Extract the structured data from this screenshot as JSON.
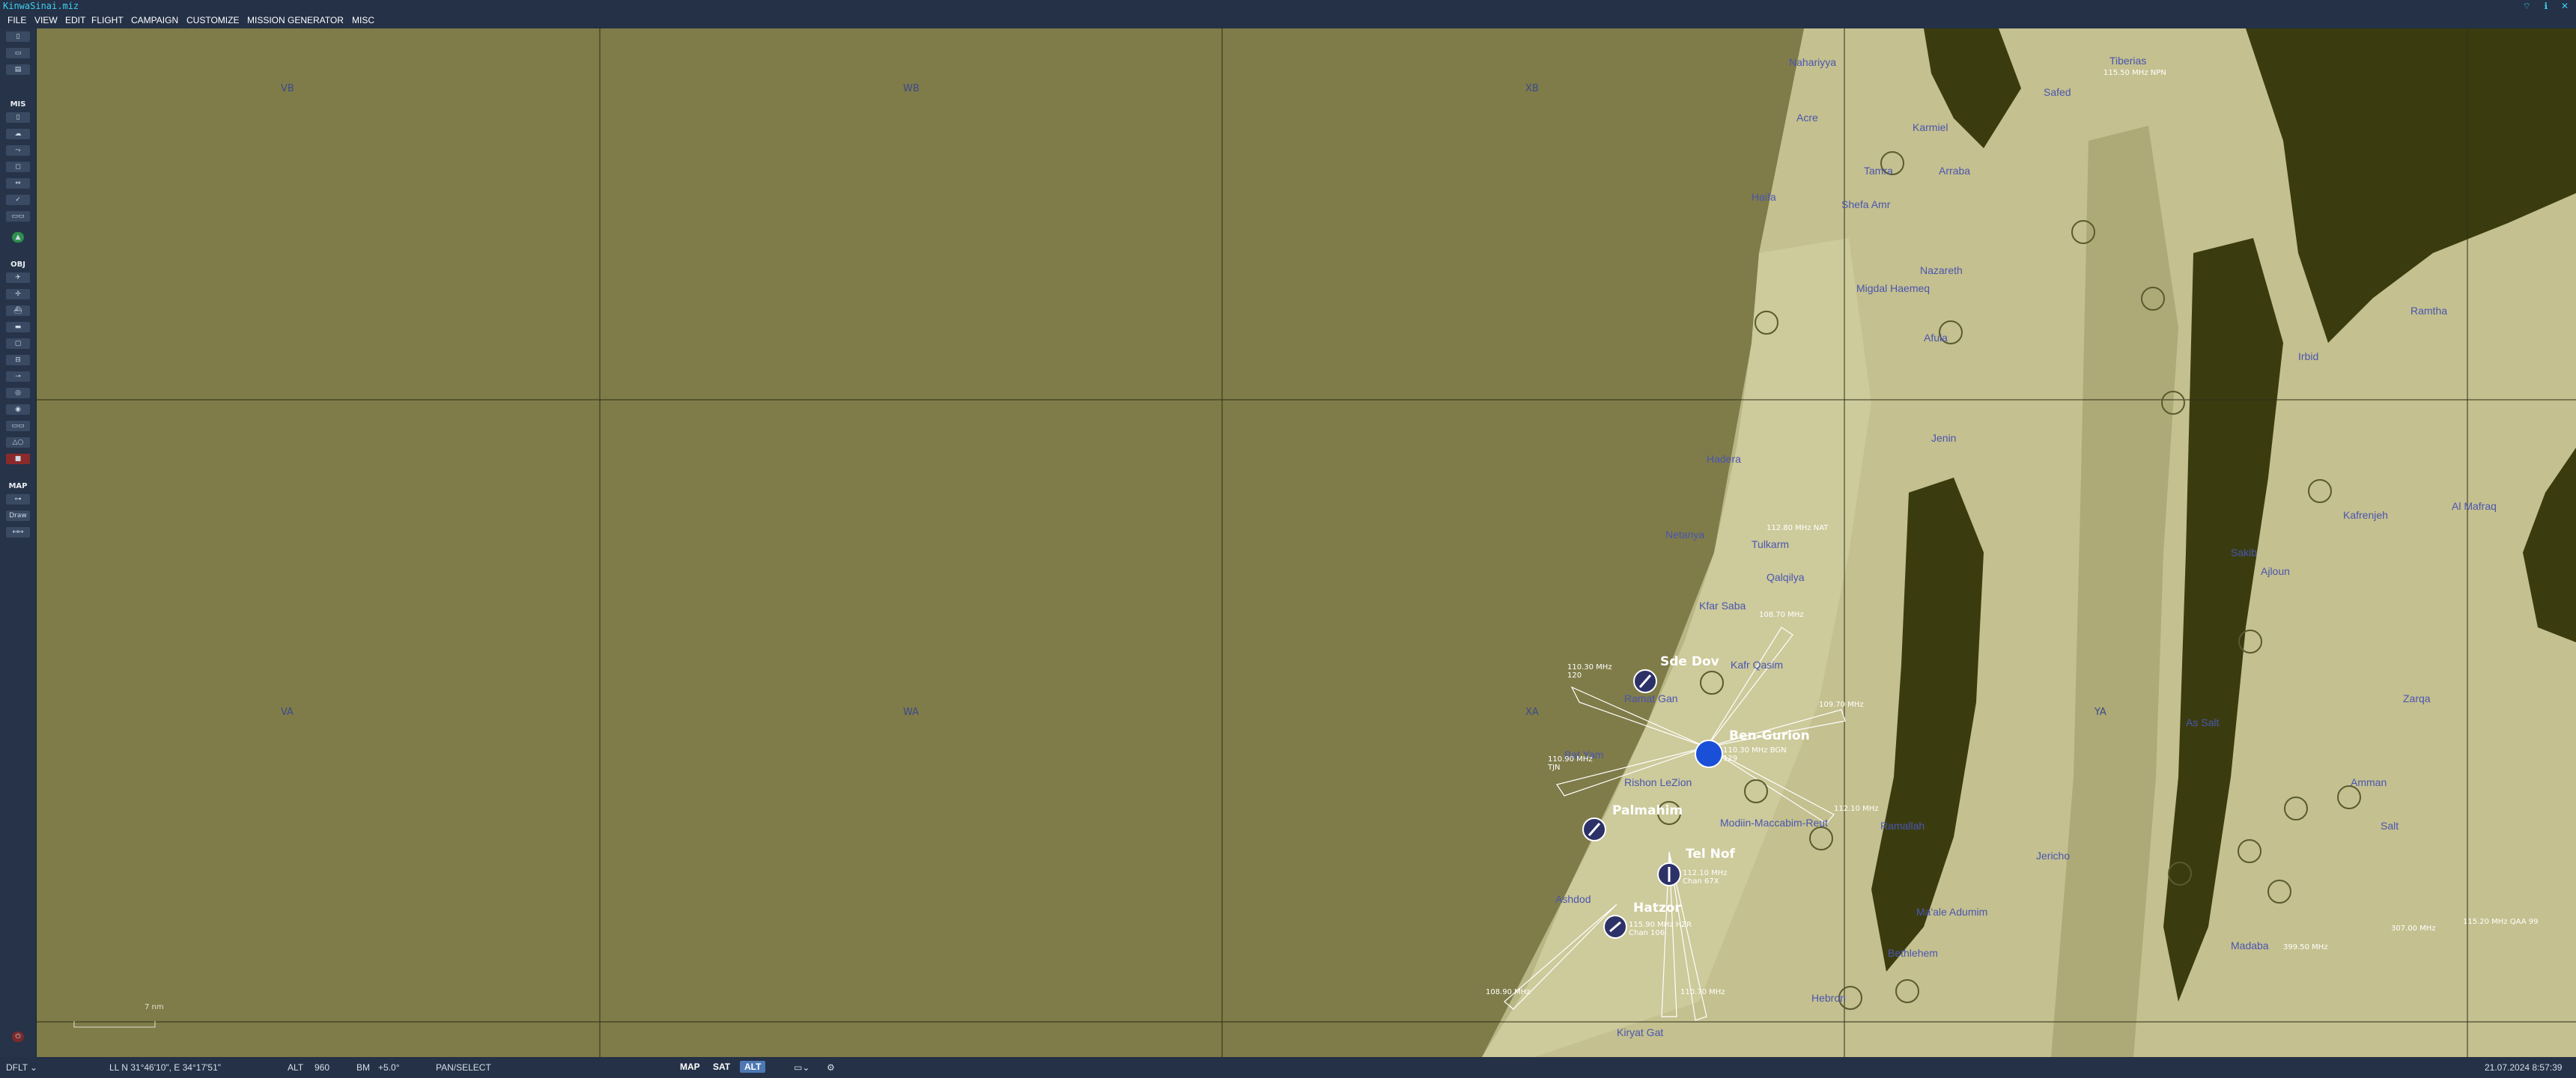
{
  "app": {
    "title": "KinwaSinai.miz"
  },
  "menu": [
    "FILE",
    "VIEW",
    "EDIT",
    "FLIGHT",
    "CAMPAIGN",
    "CUSTOMIZE",
    "MISSION GENERATOR",
    "MISC"
  ],
  "toolbar": {
    "sections": {
      "mis": "MIS",
      "obj": "OBJ",
      "map": "MAP"
    },
    "draw_label": "Draw"
  },
  "map": {
    "grid_labels": [
      "VB",
      "WB",
      "XB",
      "VA",
      "WA",
      "XA",
      "YA"
    ],
    "scale_label": "7 nm",
    "towns": [
      "Nahariyya",
      "Acre",
      "Karmiel",
      "Tamra",
      "Arraba",
      "Shefa Amr",
      "Nazareth",
      "Migdal Haemeq",
      "Afula",
      "Hadera",
      "Netanya",
      "Tulkarm",
      "Jenin",
      "Qalqilya",
      "Kfar Saba",
      "Kafr Qasim",
      "Ramat Gan",
      "Bat Yam",
      "Rishon LeZion",
      "Modiin-Maccabim-Reut",
      "Ramallah",
      "Ashdod",
      "Ma'ale Adumim",
      "Kiryat Gat",
      "Hebron",
      "Bethlehem",
      "Jericho",
      "Irbid",
      "Ramtha",
      "Salt",
      "Amman",
      "Zarqa",
      "As Salt",
      "Madaba",
      "Al Mafraq",
      "Sakib",
      "Kafrenjeh",
      "Ajloun",
      "Tiberias",
      "Safed",
      "Haifa"
    ],
    "airbases": [
      {
        "name": "Sde Dov",
        "freq": "110.30 MHz",
        "ch": "120"
      },
      {
        "name": "Ben-Gurion",
        "freq": "110.30 MHz BGN",
        "ch": "129"
      },
      {
        "name": "Palmahim",
        "freq": "110.90 MHz",
        "ch": "TJN"
      },
      {
        "name": "Tel Nof",
        "freq": "112.10 MHz",
        "ch": "Chan 67X"
      },
      {
        "name": "Hatzor",
        "freq": "115.90 MHz HZR",
        "ch": "Chan 106"
      }
    ],
    "nav_labels": [
      "108.70 MHz",
      "109.70 MHz",
      "112.80 MHz NAT",
      "115.50 MHz NPN",
      "115.20 MHz QAA 99",
      "307.00 MHz",
      "399.50 MHz",
      "108.90 MHz",
      "110.70 MHz",
      "112.10 MHz"
    ]
  },
  "status": {
    "coord_mode": "DFLT",
    "ll": "LL   N 31°46'10\", E 34°17'51\"",
    "alt_label": "ALT",
    "alt_value": "960",
    "bm": "BM",
    "bm_value": "+5.0°",
    "tool": "PAN/SELECT",
    "modes": [
      "MAP",
      "SAT",
      "ALT"
    ],
    "active_mode": "ALT",
    "datetime": "21.07.2024 8:57:39"
  },
  "colors": {
    "sea": "#7f7c49",
    "land": "#c4c08f",
    "land_dark": "#3a3c10",
    "ui": "#243147",
    "label": "#4a55b0"
  }
}
